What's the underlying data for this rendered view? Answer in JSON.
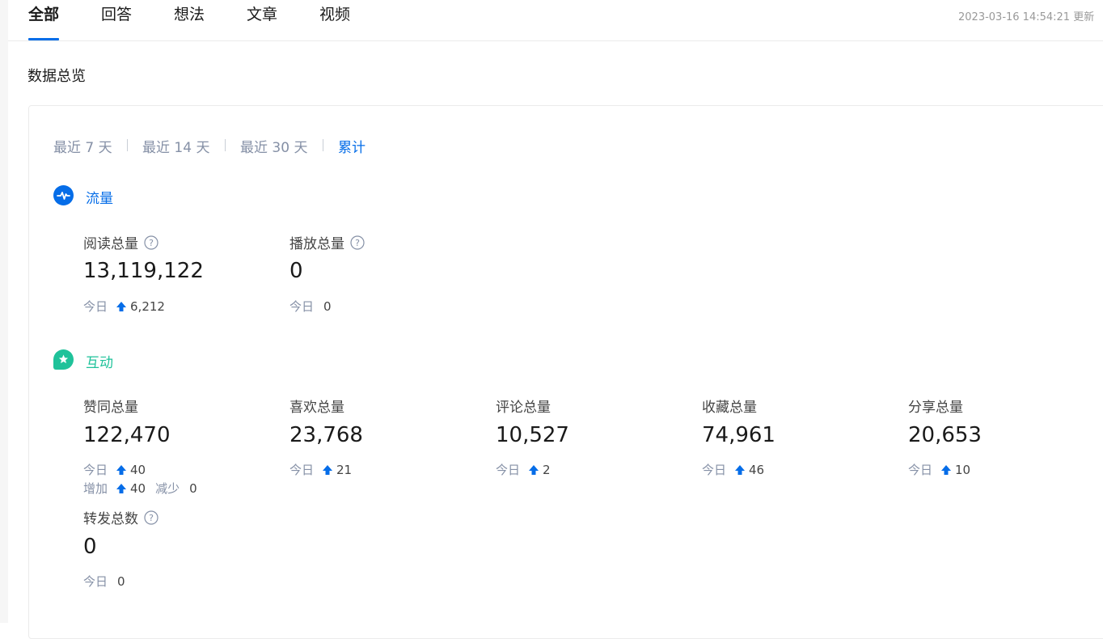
{
  "tabs": [
    "全部",
    "回答",
    "想法",
    "文章",
    "视频"
  ],
  "updated_text": "2023-03-16 14:54:21 更新",
  "overview_title": "数据总览",
  "ranges": [
    "最近 7 天",
    "最近 14 天",
    "最近 30 天",
    "累计"
  ],
  "active_range": "累计",
  "colors": {
    "accent": "#056de8",
    "interaction": "#1fc29a"
  },
  "traffic": {
    "label": "流量",
    "icon": "pulse-icon",
    "metrics": [
      {
        "label": "阅读总量",
        "value": "13,119,122",
        "today_label": "今日",
        "today": "6,212"
      },
      {
        "label": "播放总量",
        "value": "0",
        "today_label": "今日",
        "today": "0"
      }
    ]
  },
  "interaction": {
    "label": "互动",
    "icon": "star-chat-icon",
    "metrics": [
      {
        "label": "赞同总量",
        "value": "122,470",
        "today_label": "今日",
        "today": "40",
        "inc_label": "增加",
        "inc": "40",
        "dec_label": "减少",
        "dec": "0"
      },
      {
        "label": "喜欢总量",
        "value": "23,768",
        "today_label": "今日",
        "today": "21"
      },
      {
        "label": "评论总量",
        "value": "10,527",
        "today_label": "今日",
        "today": "2"
      },
      {
        "label": "收藏总量",
        "value": "74,961",
        "today_label": "今日",
        "today": "46"
      },
      {
        "label": "分享总量",
        "value": "20,653",
        "today_label": "今日",
        "today": "10"
      },
      {
        "label": "转发总数",
        "value": "0",
        "today_label": "今日",
        "today": "0"
      }
    ]
  }
}
